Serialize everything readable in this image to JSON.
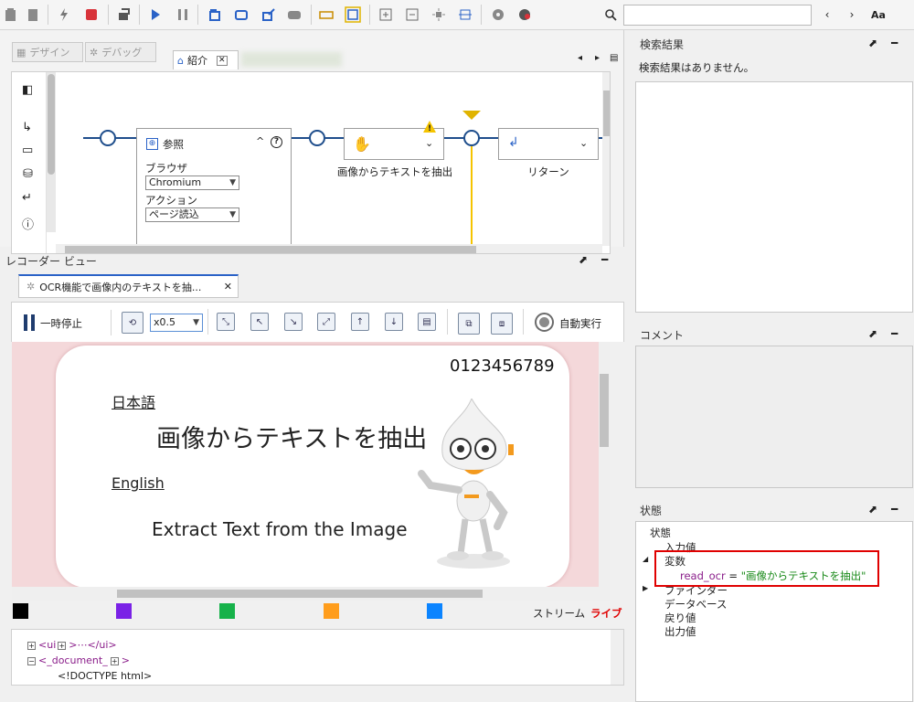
{
  "toolbar": {
    "font_button": "Aa",
    "search_value": ""
  },
  "design": {
    "tab_design": "デザイン",
    "tab_debug": "デバッグ",
    "tab_intro": "紹介",
    "nodes": {
      "browse": {
        "title": "参照",
        "browser_label": "ブラウザ",
        "browser_value": "Chromium",
        "action_label": "アクション",
        "action_value": "ページ読込"
      },
      "extract": {
        "caption": "画像からテキストを抽出"
      },
      "return": {
        "caption": "リターン"
      }
    }
  },
  "recorder": {
    "title": "レコーダー ビュー",
    "tab_label": "OCR機能で画像内のテキストを抽...",
    "pause_label": "一時停止",
    "speed_value": "x0.5",
    "auto_label": "自動実行",
    "preview": {
      "digits": "0123456789",
      "ja_heading": "日本語",
      "ja_text": "画像からテキストを抽出",
      "en_heading": "English",
      "en_text": "Extract Text from the Image"
    },
    "stream_label": "ストリーム",
    "live_label": "ライブ",
    "swatch_colors": [
      "#000000",
      "#7a22e6",
      "#16b24a",
      "#ff9d1c",
      "#0b84ff"
    ],
    "dom": {
      "line1_open": "<ui",
      "line1_rest": ">⋯</ui>",
      "line2": "<_document_",
      "line2_end": ">",
      "line3": "<!DOCTYPE html>"
    }
  },
  "search_results": {
    "title": "検索結果",
    "empty_message": "検索結果はありません。"
  },
  "comment": {
    "title": "コメント"
  },
  "state": {
    "title": "状態",
    "root": "状態",
    "input_values": "入力値",
    "variables": "変数",
    "var_name": "read_ocr",
    "var_eq": " = ",
    "var_value": "\"画像からテキストを抽出\"",
    "finder": "ファインダー",
    "database": "データベース",
    "return_value": "戻り値",
    "output_value": "出力値"
  },
  "colors": {
    "accent": "#1f4e8c",
    "highlight": "#e00000",
    "warning": "#f5c400"
  }
}
